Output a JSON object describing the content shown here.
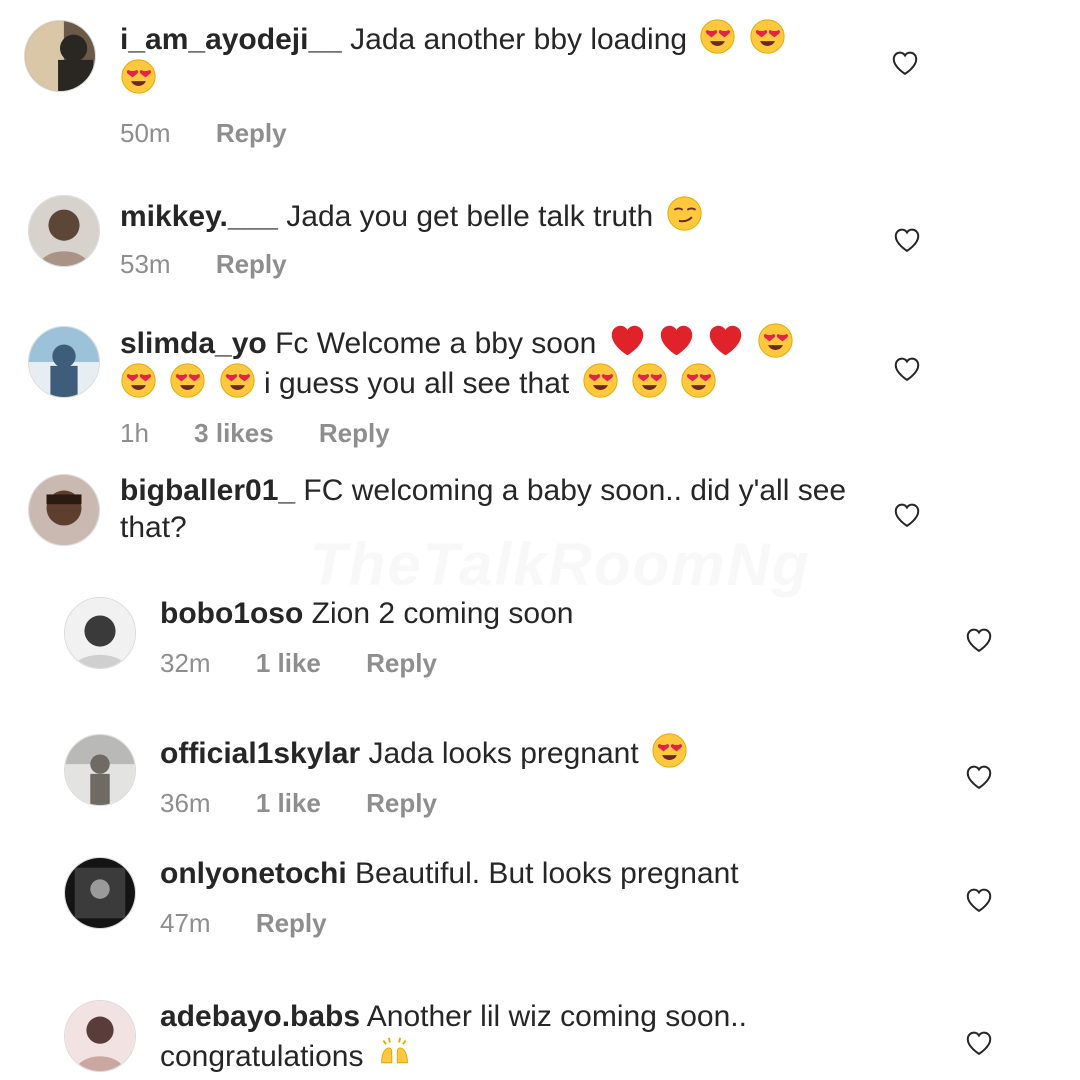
{
  "watermark": "TheTalkRoomNg",
  "comments": [
    {
      "username": "i_am_ayodeji__",
      "text": "Jada another bby loading",
      "emojis": [
        "heart-eyes",
        "heart-eyes",
        "heart-eyes"
      ],
      "time": "50m",
      "likes": "",
      "reply": "Reply",
      "avatar_colors": [
        "#6b5a48",
        "#d9c7a8",
        "#2a2723"
      ]
    },
    {
      "username": "mikkey.___",
      "text": "Jada you get belle talk truth",
      "emojis": [
        "smirk"
      ],
      "time": "53m",
      "likes": "",
      "reply": "Reply",
      "avatar_colors": [
        "#a89384",
        "#5b4637",
        "#d8d2cc"
      ]
    },
    {
      "username": "slimda_yo",
      "text": "Fc Welcome a bby soon",
      "emojis_1": [
        "red-heart",
        "red-heart",
        "red-heart",
        "heart-eyes",
        "heart-eyes",
        "heart-eyes",
        "heart-eyes"
      ],
      "text2": "i guess you all see that",
      "emojis_2": [
        "heart-eyes",
        "heart-eyes",
        "heart-eyes"
      ],
      "time": "1h",
      "likes": "3 likes",
      "reply": "Reply",
      "avatar_colors": [
        "#9bc2d8",
        "#3e5d7b",
        "#e6eef4"
      ]
    },
    {
      "username": "bigballer01_",
      "text": "FC welcoming a baby soon.. did y'all see that?",
      "time": "",
      "likes": "",
      "reply": "",
      "avatar_colors": [
        "#5e3f2e",
        "#2b1a12",
        "#c9b9b0"
      ]
    },
    {
      "username": "bobo1oso",
      "text": "Zion 2 coming soon",
      "time": "32m",
      "likes": "1 like",
      "reply": "Reply",
      "avatar_colors": [
        "#cfcfcf",
        "#3a3a3a",
        "#f1f1f1"
      ]
    },
    {
      "username": "official1skylar",
      "text": "Jada looks pregnant",
      "emojis": [
        "heart-eyes"
      ],
      "time": "36m",
      "likes": "1 like",
      "reply": "Reply",
      "avatar_colors": [
        "#b9b9b7",
        "#6f6a64",
        "#e3e3e1"
      ]
    },
    {
      "username": "onlyonetochi",
      "text": "Beautiful. But looks pregnant",
      "time": "47m",
      "likes": "",
      "reply": "Reply",
      "avatar_colors": [
        "#3b3b3b",
        "#9a9a9a",
        "#141414"
      ]
    },
    {
      "username": "adebayo.babs",
      "text": "Another lil wiz coming soon..",
      "text2": "congratulations",
      "emojis": [
        "raising-hands"
      ],
      "time": "",
      "likes": "",
      "reply": "",
      "avatar_colors": [
        "#caa7a1",
        "#5a3c3a",
        "#f2e2e1"
      ]
    }
  ]
}
